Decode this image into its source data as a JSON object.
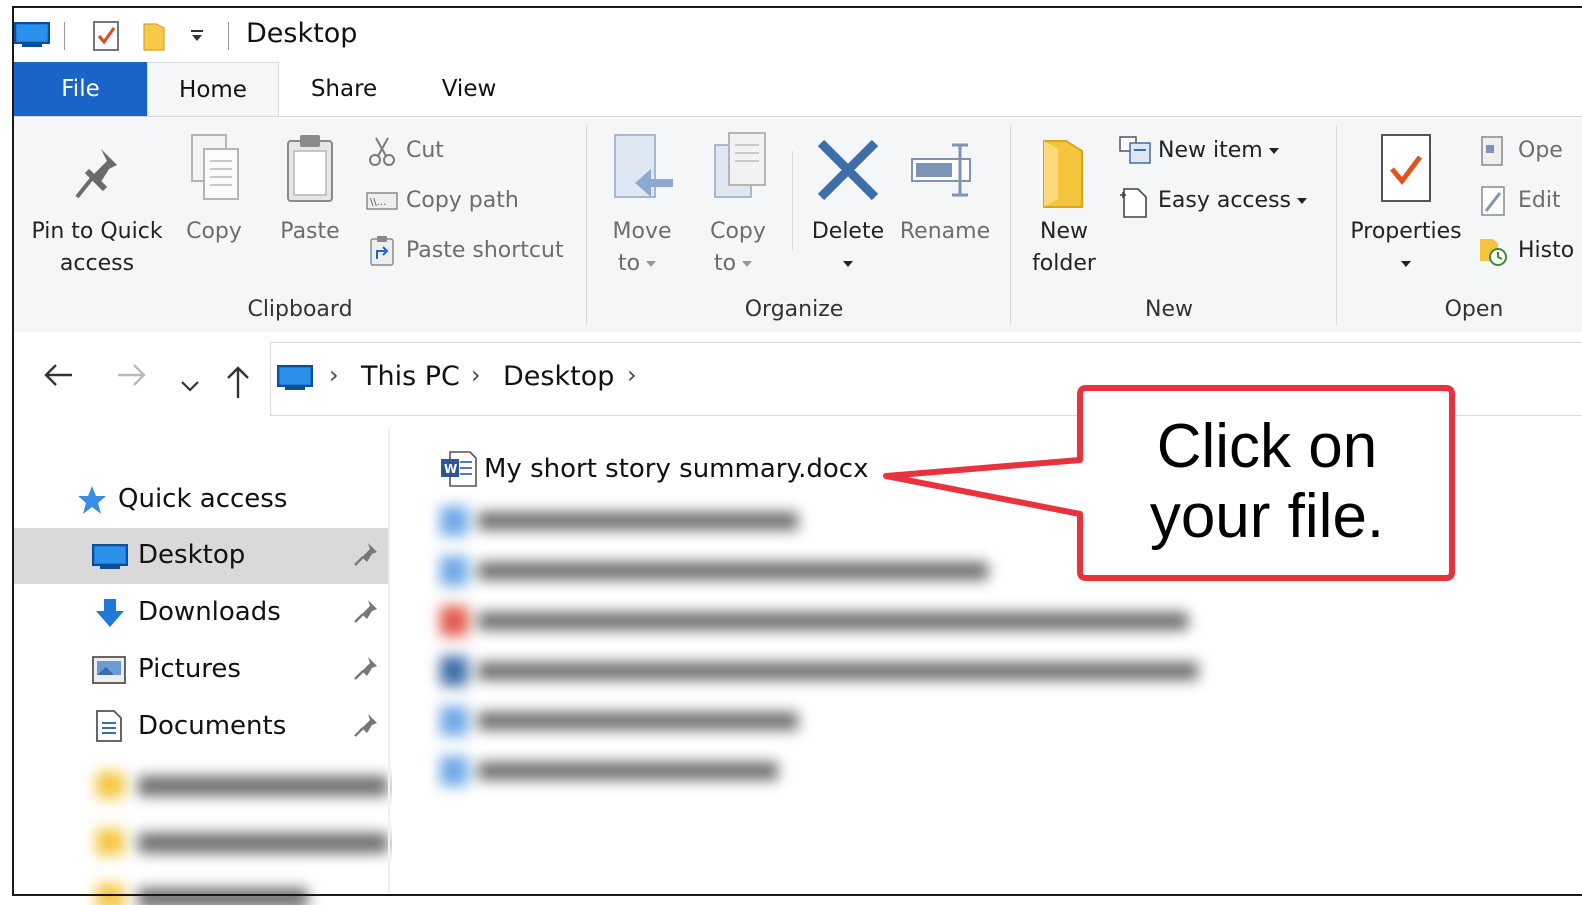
{
  "window": {
    "title": "Desktop"
  },
  "tabs": [
    "File",
    "Home",
    "Share",
    "View"
  ],
  "ribbon": {
    "clipboard": {
      "label": "Clipboard",
      "pin_line1": "Pin to Quick",
      "pin_line2": "access",
      "copy": "Copy",
      "paste": "Paste",
      "cut": "Cut",
      "copy_path": "Copy path",
      "paste_shortcut": "Paste shortcut"
    },
    "organize": {
      "label": "Organize",
      "move_line1": "Move",
      "move_line2": "to",
      "copy_line1": "Copy",
      "copy_line2": "to",
      "delete": "Delete",
      "rename": "Rename"
    },
    "new": {
      "label": "New",
      "folder_line1": "New",
      "folder_line2": "folder",
      "new_item": "New item",
      "easy_access": "Easy access"
    },
    "open": {
      "label": "Open",
      "properties": "Properties",
      "open": "Ope",
      "edit": "Edit",
      "history": "Histo"
    }
  },
  "address": {
    "crumbs": [
      "This PC",
      "Desktop"
    ]
  },
  "sidebar": {
    "quick_access": "Quick access",
    "items": [
      {
        "label": "Desktop",
        "selected": true
      },
      {
        "label": "Downloads"
      },
      {
        "label": "Pictures"
      },
      {
        "label": "Documents"
      }
    ]
  },
  "files": {
    "visible": "My short story summary.docx"
  },
  "callout": {
    "line1": "Click on",
    "line2": "your file.",
    "border_color": "#e8333f"
  },
  "colors": {
    "file_tab": "#1a64c8",
    "ribbon_bg": "#f5f6f7",
    "selected_bg": "#d9d9d9"
  }
}
